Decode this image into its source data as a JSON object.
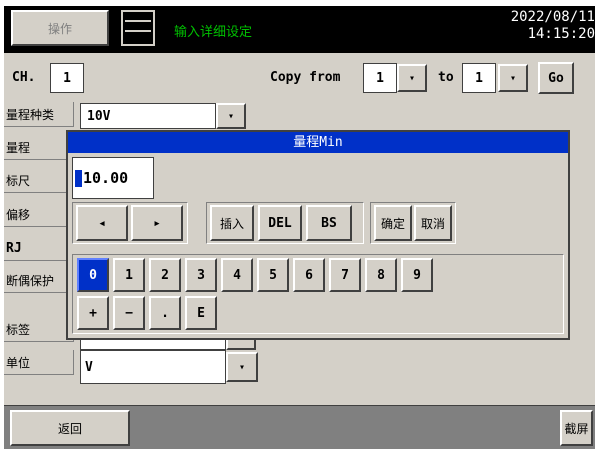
{
  "header": {
    "ops_label": "操作",
    "title": "输入详细设定",
    "date": "2022/08/11",
    "time": "14:15:20"
  },
  "channel_row": {
    "ch_label": "CH.",
    "ch_value": "1",
    "copy_from_label": "Copy from",
    "copy_from_value": "1",
    "to_label": "to",
    "to_value": "1",
    "go_label": "Go"
  },
  "fields": {
    "range_type_label": "量程种类",
    "range_type_value": "10V",
    "range_label": "量程",
    "scale_label": "标尺",
    "offset_label": "偏移",
    "rj_label": "RJ",
    "burnout_label": "断偶保护",
    "tag_label": "标签",
    "unit_label": "单位",
    "unit_value": "V"
  },
  "dialog": {
    "title": "量程Min",
    "entry_value": "10.00",
    "left_arrow": "◂",
    "right_arrow": "▸",
    "insert_label": "插入",
    "del_label": "DEL",
    "bs_label": "BS",
    "confirm_label": "确定",
    "cancel_label": "取消",
    "keys_row1": [
      "0",
      "1",
      "2",
      "3",
      "4",
      "5",
      "6",
      "7",
      "8",
      "9"
    ],
    "keys_row2": [
      "+",
      "−",
      ".",
      "E"
    ]
  },
  "footer": {
    "back_label": "返回",
    "screenshot_label": "截屏"
  },
  "dropdown_glyph": "▾",
  "colors": {
    "title_green": "#00c000",
    "dialog_blue": "#0030c8",
    "panel_gray": "#d4d0c8"
  }
}
